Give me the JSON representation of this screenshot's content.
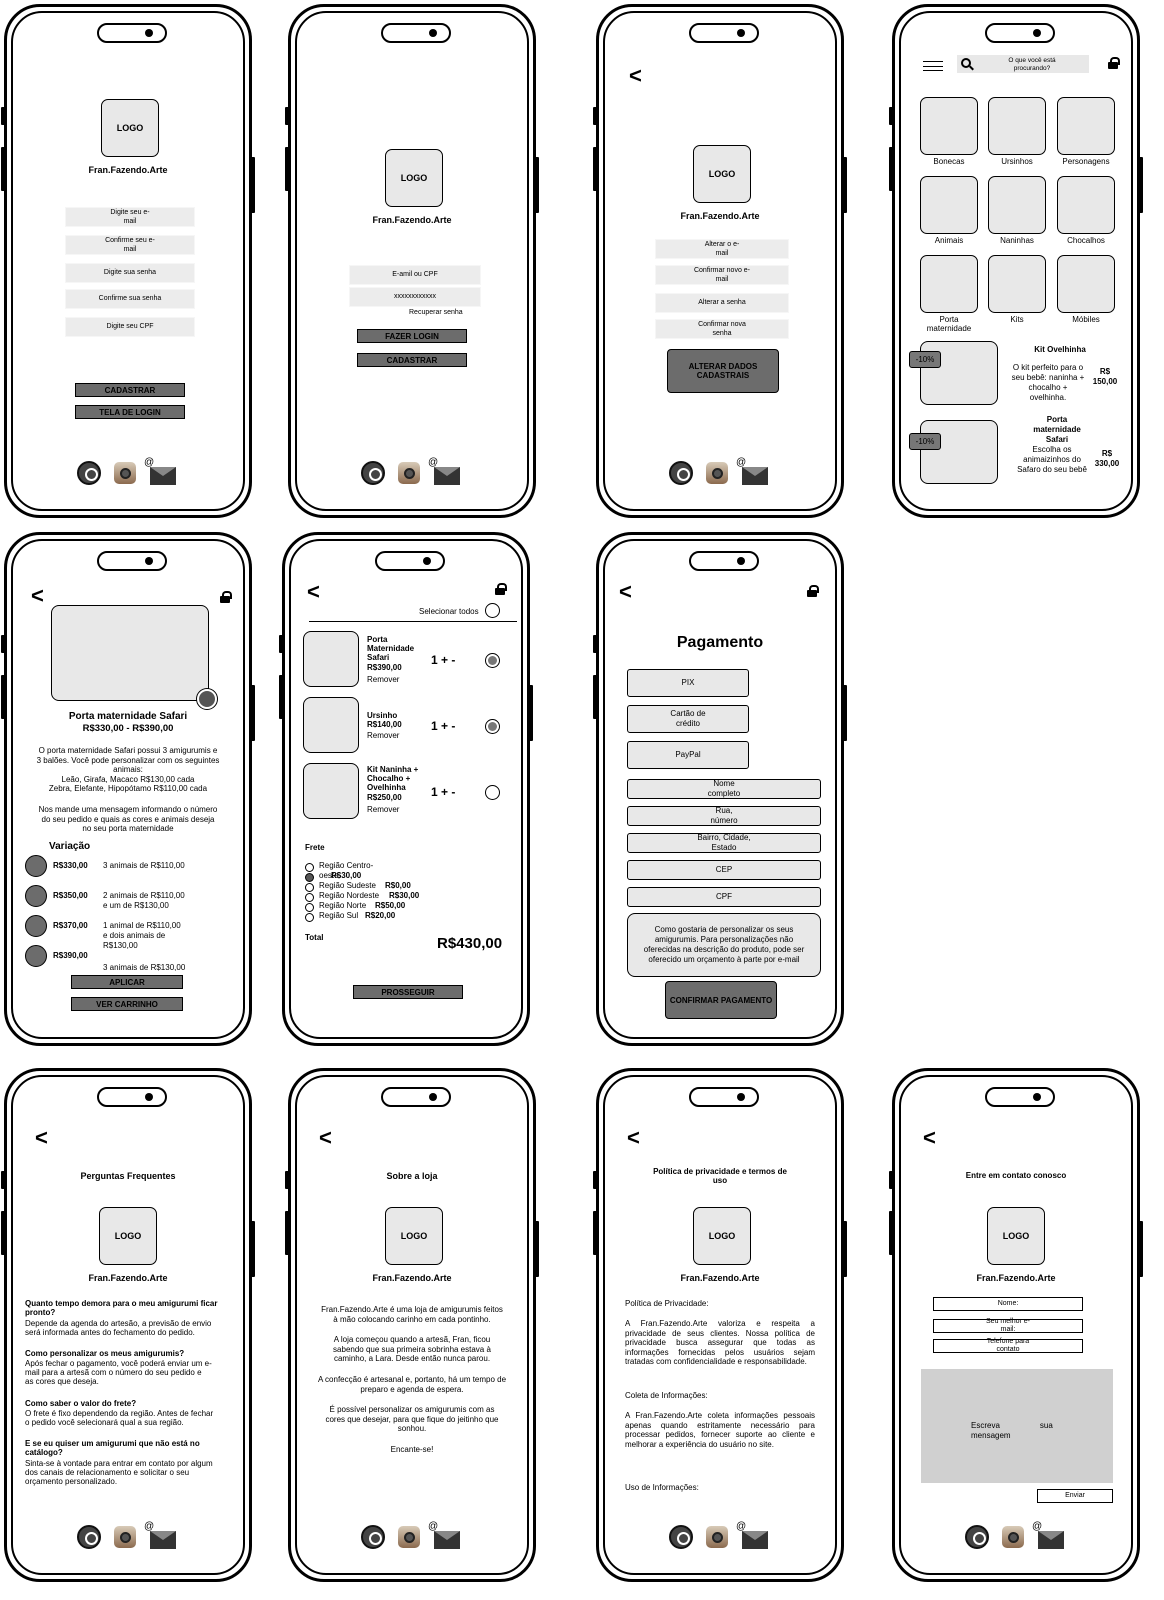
{
  "brand": "Fran.Fazendo.Arte",
  "logo": "LOGO",
  "back": "<",
  "screen1": {
    "fields": [
      "Digite seu e-\nmail",
      "Confirme seu e-\nmail",
      "Digite sua senha",
      "Confirme sua senha",
      "Digite seu CPF"
    ],
    "btn_register": "CADASTRAR",
    "btn_login_screen": "TELA DE LOGIN"
  },
  "screen2": {
    "fields": [
      "E-amil ou CPF",
      "xxxxxxxxxxxx"
    ],
    "recover": "Recuperar senha",
    "btn_login": "FAZER LOGIN",
    "btn_register": "CADASTRAR"
  },
  "screen3": {
    "fields": [
      "Alterar o e-\nmail",
      "Confirmar novo e-\nmail",
      "Alterar a senha",
      "Confirmar nova\nsenha"
    ],
    "btn_change": "ALTERAR DADOS\nCADASTRAIS"
  },
  "screen4": {
    "search_placeholder": "O que você está\nprocurando?",
    "categories": [
      "Bonecas",
      "Ursinhos",
      "Personagens",
      "Animais",
      "Naninhas",
      "Chocalhos",
      "Porta\nmaternidade",
      "Kits",
      "Móbiles"
    ],
    "promo1": {
      "badge": "-10%",
      "title": "Kit Ovelhinha",
      "desc": "O kit perfeito para o\nseu bebê: naninha +\nchocalho +\novelhinha.",
      "price": "R$\n150,00"
    },
    "promo2": {
      "badge": "-10%",
      "title": "Porta\nmaternidade\nSafari",
      "desc": "Escolha os\nanimaizinhos do\nSafaro do seu bebê",
      "price": "R$\n330,00"
    }
  },
  "screen5": {
    "title": "Porta maternidade Safari",
    "price": "R$330,00 - R$390,00",
    "desc1": "O porta maternidade Safari possui 3 amigurumis e\n3 balões. Você pode personalizar com os seguintes\nanimais:\nLeão, Girafa, Macaco R$130,00 cada\nZebra, Elefante, Hipopótamo R$110,00 cada",
    "desc2": "Nos mande uma mensagem informando o número\ndo seu pedido e quais as cores e animais deseja\nno seu porta maternidade",
    "variation_label": "Variação",
    "variations": [
      {
        "price": "R$330,00",
        "desc": "3 animais de R$110,00"
      },
      {
        "price": "R$350,00",
        "desc": "2 animais de R$110,00\ne um de R$130,00"
      },
      {
        "price": "R$370,00",
        "desc": "1 animal de R$110,00\ne dois animais de\nR$130,00"
      },
      {
        "price": "R$390,00",
        "desc": "3 animais de R$130,00"
      }
    ],
    "btn_apply": "APLICAR",
    "btn_cart": "VER CARRINHO"
  },
  "screen6": {
    "select_all": "Selecionar todos",
    "items": [
      {
        "name": "Porta\nMaternidade\nSafari\nR$390,00",
        "remove": "Remover",
        "qty": "1 + -"
      },
      {
        "name": "Ursinho\nR$140,00",
        "remove": "Remover",
        "qty": "1 + -"
      },
      {
        "name": "Kit Naninha +\nChocalho +\nOvelhinha\nR$250,00",
        "remove": "Remover",
        "qty": "1 + -"
      }
    ],
    "freight_label": "Frete",
    "regions": [
      {
        "name": "Região Centro-\noeste",
        "price": "R$30,00"
      },
      {
        "name": "Região Sudeste",
        "price": "R$0,00"
      },
      {
        "name": "Região Nordeste",
        "price": "R$30,00"
      },
      {
        "name": "Região Norte",
        "price": "R$50,00"
      },
      {
        "name": "Região Sul",
        "price": "R$20,00"
      }
    ],
    "total_label": "Total",
    "total": "R$430,00",
    "btn_next": "PROSSEGUIR"
  },
  "screen7": {
    "title": "Pagamento",
    "methods": [
      "PIX",
      "Cartão de\ncrédito",
      "PayPal"
    ],
    "fields": [
      "Nome\ncompleto",
      "Rua,\nnúmero",
      "Bairro, Cidade,\nEstado",
      "CEP",
      "CPF"
    ],
    "note": "Como gostaria de personalizar os seus\namigurumis. Para personalizações não\noferecidas na descrição do produto, pode ser\noferecido um orçamento à parte por e-mail",
    "btn_confirm": "CONFIRMAR PAGAMENTO"
  },
  "screen8": {
    "title": "Perguntas Frequentes",
    "faq": [
      {
        "q": "Quanto tempo demora para o meu amigurumi ficar\npronto?",
        "a": "Depende da agenda do artesão, a previsão de envio\nserá informada antes do fechamento do pedido."
      },
      {
        "q": "Como personalizar os meus amigurumis?",
        "a": "Após fechar o pagamento, você poderá enviar um e-\nmail para a artesã com o número do seu pedido e\nas cores que deseja."
      },
      {
        "q": "Como saber o valor do frete?",
        "a": "O frete é fixo dependendo da região. Antes de fechar\no pedido você selecionará qual a sua região."
      },
      {
        "q": "E se eu quiser um amigurumi que não está no\ncatálogo?",
        "a": "Sinta-se à vontade para entrar em contato por algum\ndos canais de relacionamento e solicitar o seu\norçamento personalizado."
      }
    ]
  },
  "screen9": {
    "title": "Sobre a loja",
    "paragraphs": [
      "Fran.Fazendo.Arte é uma loja de amigurumis feitos\nà mão colocando carinho em cada pontinho.",
      "A loja começou quando a artesã, Fran, ficou\nsabendo que sua primeira sobrinha estava à\ncaminho, a Lara. Desde então nunca parou.",
      "A confecção é artesanal e, portanto, há um tempo de\npreparo e agenda de espera.",
      "É possível personalizar os amigurumis com as\ncores que desejar, para que fique do jeitinho que\nsonhou.",
      "Encante-se!"
    ]
  },
  "screen10": {
    "title": "Política de privacidade e termos de\nuso",
    "h1": "Política de Privacidade:",
    "p1": "A Fran.Fazendo.Arte valoriza e respeita a privacidade de seus clientes. Nossa política de privacidade busca assegurar que todas as informações fornecidas pelos usuários sejam tratadas com confidencialidade e responsabilidade.",
    "h2": "Coleta de Informações:",
    "p2": "A Fran.Fazendo.Arte coleta informações pessoais apenas quando estritamente necessário para processar pedidos, fornecer suporte ao cliente e melhorar a experiência do usuário no site.",
    "h3": "Uso de Informações:"
  },
  "screen11": {
    "title": "Entre em contato conosco",
    "fields": [
      "Nome:",
      "Seu melhor e-\nmail:",
      "Telefone para\ncontato"
    ],
    "message_placeholder": "Escreva                  sua\nmensagem",
    "btn_send": "Enviar"
  }
}
